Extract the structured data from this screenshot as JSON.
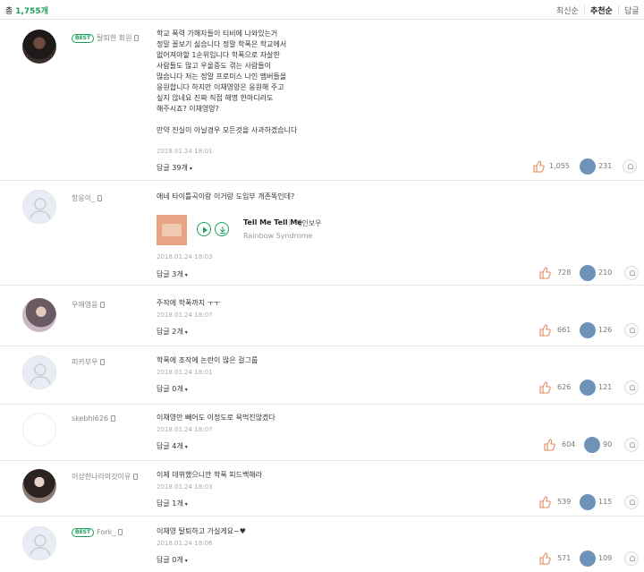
{
  "header": {
    "count_prefix": "총",
    "count": "1,755개",
    "sort_latest": "최신순",
    "sort_recommended": "추천순",
    "sort_more": "답글"
  },
  "colors": {
    "accent": "#1aa15c",
    "down": "#6d93b8",
    "up": "#e08a5a"
  },
  "comments": [
    {
      "user": "탈퇴한 회원",
      "badge": "BEST",
      "text": "학교 폭력 가해자들이 티비에 나와있는거\n정말 꼴보기 싫습니다 정말 학폭은 학교에서\n없어져야할 1순위입니다 학폭으로 자살한\n사람들도 많고 우울증도 겪는 사람들이\n많습니다 저는 정말 프로미스 나인 멤버들을\n응원합니다 하지만 이채영양은 응원해 주고\n싶지 않네요 진짜 직접 해명 한마디라도\n해주시죠? 이채영양?\n\n만약 진실이 아닐경우 모든것을 사과하겠습니다",
      "date": "2018.01.24 18:01",
      "replies": "답글 39개",
      "up": "1,055",
      "down": "231"
    },
    {
      "user": "함응이_",
      "text": "애네 타이틀곡이랑 이거랑 도입부 개존똑인데?",
      "music": {
        "title": "Tell Me Tell Me",
        "artist": "레인보우",
        "album": "Rainbow Syndrome"
      },
      "date": "2018.01.24 18:03",
      "replies": "답글 3개",
      "up": "728",
      "down": "210"
    },
    {
      "user": "우애영웅",
      "text": "주작에 학폭까지 ㅜㅜ",
      "date": "2018.01.24 18:07",
      "replies": "답글 2개",
      "up": "661",
      "down": "126"
    },
    {
      "user": "피카부우",
      "text": "학폭에 조작에 논란이 많은 걸그룹",
      "date": "2018.01.24 18:01",
      "replies": "답글 0개",
      "up": "626",
      "down": "121"
    },
    {
      "user": "skebhl626",
      "text": "이채영만 빼어도 이정도로 욕먹진않겠다",
      "date": "2018.01.24 18:07",
      "replies": "답글 4개",
      "up": "604",
      "down": "90"
    },
    {
      "user": "이상한나라의갓이유",
      "text": "이제 데뷔했으니깐 학폭 피드백해라",
      "date": "2018.01.24 18:03",
      "replies": "답글 1개",
      "up": "539",
      "down": "115"
    },
    {
      "user": "Fork_",
      "badge": "BEST",
      "text": "이채영 탈퇴하고 가실게요~♥",
      "date": "2018.01.24 18:06",
      "replies": "답글 0개",
      "up": "571",
      "down": "109"
    }
  ]
}
